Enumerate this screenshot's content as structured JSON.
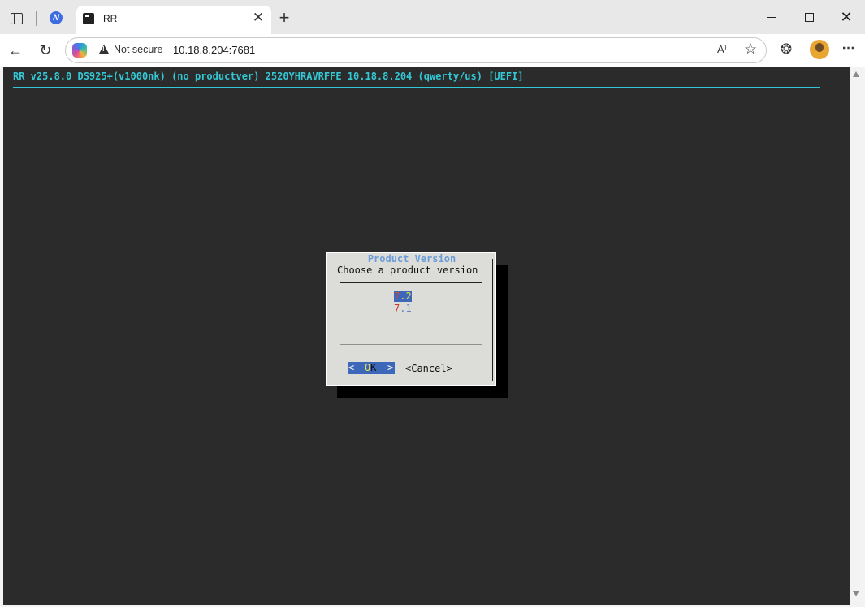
{
  "browser": {
    "tab_title": "RR",
    "address": {
      "security_label": "Not secure",
      "url": "10.18.8.204:7681"
    },
    "icons": [
      "tab-actions-icon",
      "app-logo-icon",
      "terminal-icon",
      "close-icon",
      "plus-icon",
      "minimize-icon",
      "maximize-icon",
      "close-window-icon",
      "back-arrow-icon",
      "reload-icon",
      "copilot-icon",
      "warning-icon",
      "read-aloud-icon",
      "favorite-star-icon",
      "extensions-icon",
      "avatar",
      "more-icon"
    ],
    "read_aloud_glyph": "A⁾",
    "more_glyph": "⋯",
    "new_tab_glyph": "+",
    "close_tab_glyph": "✕",
    "close_window_glyph": "✕",
    "back_glyph": "←",
    "reload_glyph": "↻",
    "star_glyph": "☆",
    "ext_glyph": "❂"
  },
  "terminal": {
    "header": "RR v25.8.0 DS925+(v1000nk) (no productver) 2520YHRAVRFFE 10.18.8.204 (qwerty/us) [UEFI]",
    "colors": {
      "background": "#2b2b2b",
      "header": "#33c8d6",
      "dialog_bg": "#dcdcd8",
      "selection": "#3d67b8"
    }
  },
  "dialog": {
    "title": "Product Version",
    "prompt": "Choose a product version",
    "items": [
      {
        "hotkey": "7",
        "rest": ".2",
        "selected": true
      },
      {
        "hotkey": "7",
        "rest": ".1",
        "selected": false
      }
    ],
    "ok": {
      "left": "<",
      "hotkey": "O",
      "rest": "K",
      "right": ">"
    },
    "cancel_label": "<Cancel>"
  }
}
